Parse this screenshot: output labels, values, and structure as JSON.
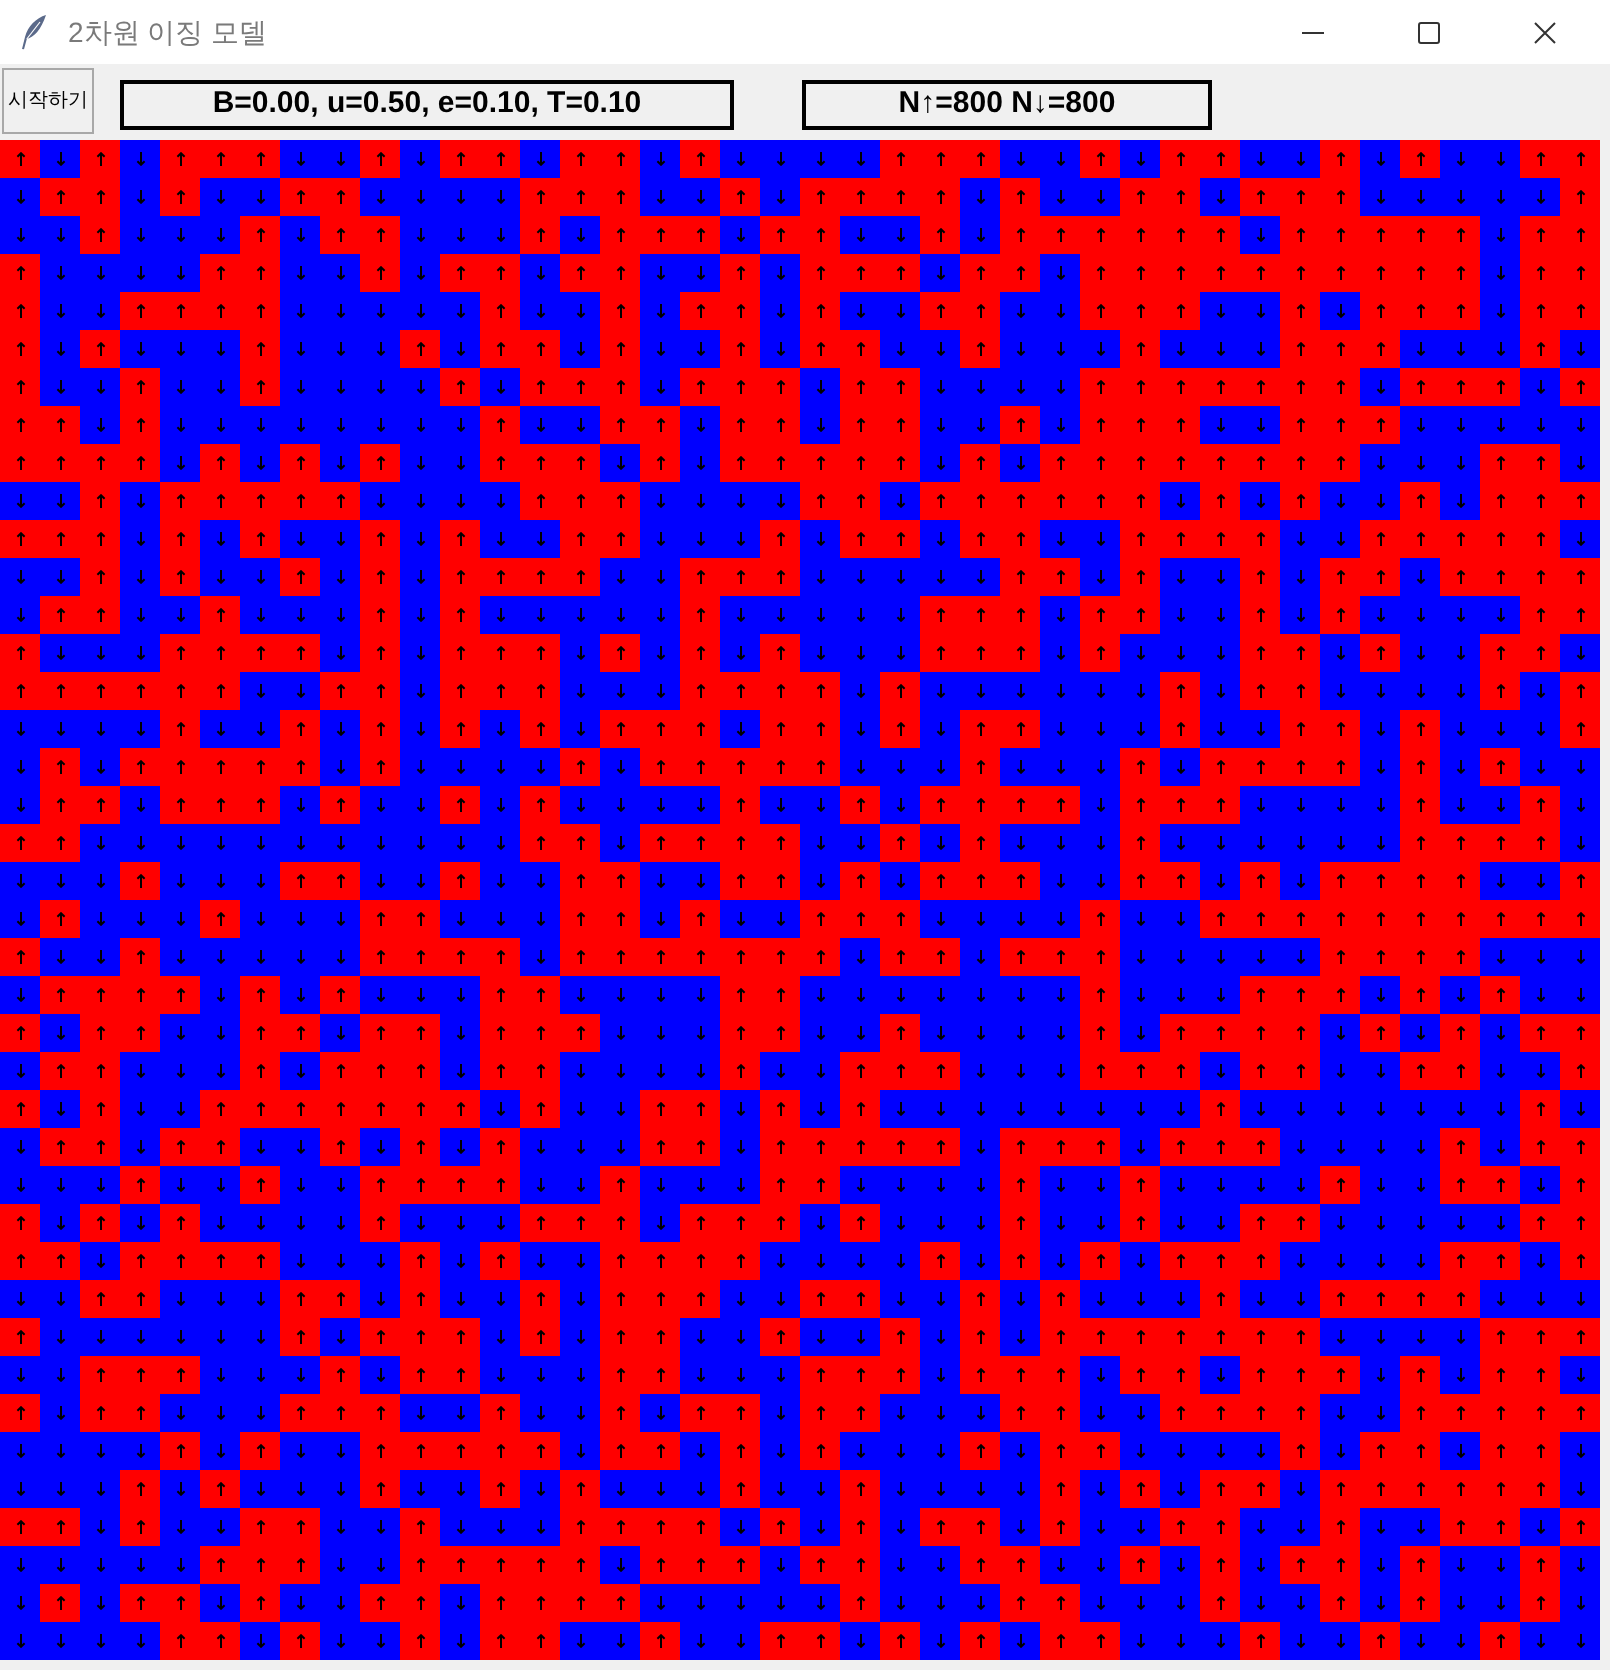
{
  "window": {
    "title": "2차원 이징 모델"
  },
  "toolbar": {
    "start_button": "시작하기",
    "parameters": "B=0.00, u=0.50, e=0.10, T=0.10",
    "counts": "N↑=800 N↓=800"
  },
  "lattice": {
    "spin_up": [
      [
        true,
        false,
        true,
        false,
        true,
        true,
        true,
        false,
        false,
        true,
        false,
        true,
        true,
        false,
        true,
        true,
        false,
        true,
        false,
        false,
        false,
        false,
        true,
        true,
        true,
        false,
        false,
        true,
        false,
        true,
        true,
        false,
        false,
        true,
        false,
        true,
        false,
        false,
        true,
        true
      ],
      [
        false,
        true,
        true,
        false,
        true,
        false,
        false,
        true,
        true,
        false,
        false,
        false,
        false,
        true,
        true,
        true,
        false,
        false,
        true,
        false,
        true,
        true,
        true,
        true,
        false,
        true,
        false,
        false,
        true,
        true,
        false,
        true,
        true,
        true,
        false,
        false,
        false,
        false,
        false,
        true
      ],
      [
        false,
        false,
        true,
        false,
        false,
        false,
        true,
        false,
        true,
        true,
        false,
        false,
        false,
        true,
        false,
        true,
        true,
        true,
        false,
        true,
        true,
        false,
        false,
        true,
        false,
        true,
        true,
        true,
        true,
        true,
        true,
        false,
        true,
        true,
        true,
        true,
        true,
        false,
        true,
        true
      ],
      [
        true,
        false,
        false,
        false,
        false,
        true,
        true,
        false,
        false,
        true,
        false,
        true,
        true,
        false,
        true,
        true,
        false,
        false,
        true,
        false,
        true,
        true,
        true,
        false,
        true,
        true,
        false,
        true,
        true,
        true,
        true,
        true,
        true,
        true,
        true,
        true,
        true,
        false,
        true,
        true
      ],
      [
        true,
        false,
        false,
        true,
        true,
        true,
        true,
        false,
        false,
        false,
        false,
        false,
        true,
        false,
        false,
        true,
        false,
        true,
        true,
        false,
        true,
        false,
        false,
        true,
        true,
        false,
        false,
        true,
        true,
        true,
        false,
        false,
        true,
        false,
        true,
        true,
        true,
        false,
        true,
        true
      ],
      [
        true,
        false,
        true,
        false,
        false,
        false,
        true,
        false,
        false,
        false,
        true,
        false,
        true,
        true,
        false,
        true,
        false,
        false,
        true,
        false,
        true,
        true,
        false,
        false,
        true,
        false,
        false,
        false,
        true,
        false,
        false,
        false,
        true,
        true,
        true,
        false,
        false,
        false,
        true,
        false
      ],
      [
        true,
        false,
        false,
        true,
        false,
        false,
        true,
        false,
        false,
        false,
        false,
        true,
        false,
        true,
        true,
        true,
        false,
        true,
        true,
        true,
        false,
        true,
        true,
        false,
        false,
        false,
        false,
        true,
        true,
        true,
        true,
        true,
        true,
        true,
        false,
        true,
        true,
        true,
        false,
        true
      ],
      [
        true,
        true,
        false,
        true,
        false,
        false,
        false,
        false,
        false,
        false,
        false,
        false,
        true,
        false,
        false,
        true,
        true,
        false,
        true,
        true,
        false,
        true,
        true,
        false,
        false,
        true,
        false,
        true,
        true,
        true,
        false,
        false,
        true,
        true,
        true,
        false,
        false,
        false,
        false,
        false
      ],
      [
        true,
        true,
        true,
        true,
        false,
        true,
        false,
        true,
        false,
        true,
        false,
        false,
        true,
        true,
        true,
        false,
        true,
        false,
        true,
        true,
        true,
        true,
        true,
        false,
        true,
        false,
        true,
        true,
        true,
        true,
        true,
        true,
        true,
        true,
        false,
        false,
        false,
        true,
        true,
        false
      ],
      [
        false,
        false,
        true,
        false,
        true,
        true,
        true,
        true,
        true,
        false,
        false,
        false,
        false,
        true,
        true,
        true,
        false,
        false,
        false,
        false,
        true,
        true,
        false,
        true,
        true,
        true,
        true,
        true,
        true,
        false,
        true,
        false,
        true,
        false,
        false,
        true,
        false,
        true,
        true,
        true
      ],
      [
        true,
        true,
        true,
        false,
        true,
        false,
        true,
        false,
        false,
        true,
        false,
        true,
        false,
        false,
        true,
        true,
        false,
        false,
        false,
        true,
        false,
        true,
        true,
        false,
        true,
        true,
        false,
        false,
        true,
        true,
        true,
        true,
        false,
        false,
        true,
        true,
        true,
        true,
        true,
        false
      ],
      [
        false,
        false,
        true,
        false,
        true,
        false,
        false,
        true,
        false,
        true,
        false,
        true,
        true,
        true,
        true,
        false,
        false,
        true,
        true,
        true,
        false,
        false,
        false,
        false,
        false,
        true,
        true,
        false,
        true,
        false,
        false,
        true,
        false,
        true,
        true,
        false,
        true,
        true,
        true,
        true
      ],
      [
        false,
        true,
        true,
        false,
        false,
        true,
        false,
        false,
        false,
        true,
        false,
        true,
        false,
        false,
        false,
        false,
        false,
        true,
        false,
        false,
        false,
        false,
        false,
        true,
        true,
        true,
        false,
        true,
        true,
        false,
        false,
        true,
        false,
        true,
        false,
        false,
        false,
        false,
        true,
        true
      ],
      [
        true,
        false,
        false,
        false,
        true,
        true,
        true,
        true,
        false,
        true,
        false,
        true,
        true,
        true,
        false,
        true,
        false,
        true,
        false,
        true,
        false,
        false,
        false,
        true,
        true,
        true,
        false,
        true,
        false,
        false,
        false,
        true,
        true,
        false,
        true,
        false,
        false,
        true,
        true,
        false
      ],
      [
        true,
        true,
        true,
        true,
        true,
        true,
        false,
        false,
        true,
        true,
        false,
        true,
        true,
        true,
        false,
        false,
        false,
        true,
        true,
        true,
        true,
        false,
        true,
        false,
        false,
        false,
        false,
        false,
        false,
        true,
        false,
        true,
        true,
        false,
        false,
        false,
        false,
        true,
        false,
        true
      ],
      [
        false,
        false,
        false,
        false,
        true,
        false,
        false,
        true,
        false,
        true,
        false,
        true,
        false,
        true,
        false,
        true,
        true,
        true,
        false,
        true,
        true,
        false,
        true,
        false,
        true,
        true,
        false,
        false,
        false,
        true,
        false,
        false,
        true,
        true,
        false,
        true,
        false,
        false,
        false,
        true
      ],
      [
        false,
        true,
        false,
        true,
        true,
        true,
        true,
        true,
        false,
        true,
        false,
        false,
        false,
        false,
        true,
        false,
        true,
        true,
        true,
        true,
        true,
        false,
        false,
        false,
        true,
        false,
        false,
        false,
        true,
        false,
        true,
        true,
        true,
        true,
        false,
        true,
        false,
        true,
        false,
        false
      ],
      [
        false,
        true,
        true,
        false,
        true,
        true,
        true,
        false,
        true,
        false,
        false,
        true,
        false,
        true,
        false,
        false,
        false,
        false,
        true,
        false,
        false,
        true,
        false,
        true,
        true,
        true,
        true,
        false,
        true,
        true,
        true,
        false,
        false,
        false,
        false,
        true,
        false,
        false,
        true,
        false
      ],
      [
        true,
        true,
        false,
        false,
        false,
        false,
        false,
        false,
        false,
        false,
        false,
        false,
        false,
        true,
        true,
        false,
        true,
        true,
        true,
        true,
        false,
        false,
        true,
        false,
        true,
        false,
        false,
        false,
        true,
        false,
        false,
        false,
        false,
        false,
        false,
        true,
        true,
        true,
        true,
        false
      ],
      [
        false,
        false,
        false,
        true,
        false,
        false,
        false,
        true,
        true,
        false,
        false,
        true,
        false,
        false,
        true,
        true,
        false,
        false,
        true,
        true,
        false,
        true,
        false,
        true,
        true,
        true,
        false,
        false,
        true,
        true,
        false,
        true,
        false,
        true,
        true,
        true,
        true,
        false,
        false,
        true
      ],
      [
        false,
        true,
        false,
        false,
        false,
        true,
        false,
        false,
        false,
        true,
        true,
        false,
        false,
        false,
        true,
        true,
        false,
        true,
        false,
        false,
        true,
        true,
        true,
        false,
        false,
        false,
        false,
        true,
        false,
        false,
        true,
        true,
        true,
        true,
        true,
        true,
        true,
        true,
        true,
        true
      ],
      [
        true,
        false,
        false,
        true,
        false,
        false,
        false,
        false,
        false,
        true,
        true,
        true,
        true,
        false,
        true,
        true,
        true,
        true,
        true,
        true,
        true,
        false,
        true,
        true,
        false,
        true,
        true,
        true,
        false,
        false,
        false,
        false,
        false,
        true,
        true,
        true,
        true,
        false,
        false,
        false
      ],
      [
        false,
        true,
        true,
        true,
        true,
        false,
        true,
        false,
        true,
        false,
        false,
        false,
        true,
        true,
        false,
        false,
        false,
        false,
        true,
        true,
        false,
        false,
        false,
        false,
        false,
        false,
        false,
        true,
        false,
        false,
        false,
        true,
        true,
        true,
        false,
        true,
        false,
        true,
        false,
        false
      ],
      [
        true,
        false,
        true,
        true,
        false,
        false,
        true,
        true,
        false,
        true,
        true,
        false,
        true,
        true,
        true,
        false,
        false,
        false,
        true,
        true,
        false,
        false,
        true,
        false,
        false,
        false,
        false,
        true,
        false,
        true,
        true,
        true,
        true,
        false,
        true,
        false,
        true,
        false,
        true,
        true
      ],
      [
        false,
        true,
        true,
        false,
        false,
        false,
        true,
        false,
        true,
        true,
        true,
        false,
        true,
        true,
        false,
        false,
        false,
        false,
        true,
        false,
        false,
        true,
        true,
        true,
        false,
        false,
        false,
        true,
        true,
        true,
        false,
        true,
        true,
        false,
        false,
        true,
        true,
        false,
        false,
        true
      ],
      [
        true,
        false,
        true,
        false,
        false,
        true,
        true,
        true,
        true,
        true,
        true,
        true,
        false,
        true,
        false,
        false,
        true,
        true,
        false,
        true,
        false,
        true,
        false,
        false,
        false,
        false,
        false,
        false,
        false,
        false,
        true,
        false,
        false,
        false,
        false,
        false,
        false,
        false,
        true,
        false
      ],
      [
        false,
        true,
        true,
        false,
        true,
        true,
        false,
        false,
        true,
        false,
        true,
        false,
        true,
        false,
        false,
        false,
        true,
        true,
        false,
        true,
        true,
        true,
        true,
        true,
        false,
        true,
        true,
        true,
        false,
        true,
        true,
        true,
        false,
        false,
        false,
        false,
        true,
        false,
        true,
        true
      ],
      [
        false,
        false,
        false,
        true,
        false,
        false,
        true,
        false,
        false,
        true,
        true,
        true,
        true,
        false,
        false,
        true,
        false,
        false,
        false,
        true,
        true,
        false,
        false,
        false,
        false,
        true,
        false,
        false,
        true,
        false,
        false,
        false,
        false,
        true,
        false,
        false,
        true,
        true,
        false,
        true
      ],
      [
        true,
        false,
        true,
        false,
        true,
        false,
        false,
        false,
        false,
        true,
        false,
        false,
        false,
        true,
        true,
        true,
        false,
        true,
        true,
        true,
        false,
        true,
        false,
        false,
        false,
        true,
        false,
        false,
        true,
        false,
        false,
        true,
        true,
        false,
        false,
        false,
        false,
        false,
        true,
        true
      ],
      [
        true,
        true,
        false,
        true,
        true,
        true,
        true,
        false,
        false,
        false,
        true,
        false,
        true,
        false,
        false,
        true,
        true,
        true,
        true,
        false,
        false,
        false,
        false,
        true,
        false,
        true,
        false,
        true,
        false,
        true,
        true,
        true,
        false,
        false,
        false,
        false,
        true,
        true,
        false,
        true
      ],
      [
        false,
        false,
        true,
        true,
        false,
        false,
        false,
        true,
        true,
        false,
        true,
        false,
        false,
        true,
        false,
        true,
        true,
        true,
        false,
        false,
        true,
        true,
        false,
        false,
        true,
        false,
        true,
        false,
        false,
        false,
        true,
        false,
        false,
        true,
        true,
        true,
        true,
        false,
        false,
        false
      ],
      [
        true,
        false,
        false,
        false,
        false,
        false,
        false,
        true,
        false,
        true,
        true,
        true,
        false,
        true,
        false,
        true,
        true,
        false,
        false,
        true,
        false,
        false,
        true,
        false,
        true,
        false,
        true,
        true,
        true,
        true,
        true,
        true,
        true,
        false,
        false,
        false,
        false,
        true,
        true,
        true
      ],
      [
        false,
        false,
        true,
        true,
        true,
        false,
        false,
        false,
        true,
        false,
        true,
        true,
        false,
        false,
        false,
        true,
        true,
        false,
        false,
        false,
        true,
        true,
        true,
        false,
        true,
        true,
        true,
        false,
        true,
        true,
        false,
        true,
        true,
        true,
        false,
        true,
        false,
        true,
        true,
        false
      ],
      [
        true,
        false,
        true,
        true,
        false,
        false,
        false,
        true,
        true,
        true,
        false,
        false,
        true,
        false,
        false,
        true,
        false,
        true,
        true,
        false,
        true,
        true,
        false,
        false,
        false,
        true,
        true,
        false,
        false,
        true,
        true,
        true,
        true,
        false,
        false,
        true,
        true,
        true,
        true,
        true
      ],
      [
        false,
        false,
        false,
        false,
        true,
        false,
        true,
        false,
        false,
        true,
        true,
        true,
        true,
        true,
        false,
        true,
        true,
        false,
        true,
        false,
        true,
        false,
        false,
        false,
        true,
        false,
        true,
        true,
        false,
        false,
        false,
        false,
        true,
        false,
        true,
        true,
        false,
        true,
        true,
        false
      ],
      [
        false,
        false,
        false,
        true,
        false,
        true,
        false,
        false,
        false,
        true,
        false,
        false,
        true,
        false,
        true,
        false,
        false,
        false,
        true,
        false,
        false,
        true,
        false,
        false,
        false,
        false,
        true,
        false,
        true,
        false,
        true,
        true,
        false,
        true,
        true,
        true,
        true,
        true,
        true,
        false
      ],
      [
        true,
        true,
        false,
        true,
        false,
        false,
        true,
        true,
        false,
        false,
        true,
        false,
        false,
        false,
        true,
        true,
        true,
        true,
        false,
        true,
        false,
        true,
        false,
        true,
        true,
        false,
        true,
        false,
        false,
        true,
        true,
        false,
        false,
        true,
        false,
        false,
        true,
        true,
        false,
        true
      ],
      [
        false,
        false,
        false,
        false,
        false,
        true,
        true,
        true,
        false,
        false,
        true,
        true,
        true,
        true,
        true,
        false,
        true,
        true,
        true,
        false,
        true,
        true,
        false,
        false,
        true,
        true,
        false,
        false,
        true,
        false,
        true,
        false,
        true,
        true,
        false,
        true,
        false,
        false,
        true,
        false
      ],
      [
        false,
        true,
        false,
        true,
        true,
        false,
        true,
        false,
        false,
        true,
        true,
        false,
        true,
        true,
        true,
        true,
        false,
        false,
        false,
        false,
        false,
        true,
        false,
        false,
        false,
        true,
        true,
        false,
        false,
        false,
        true,
        false,
        false,
        true,
        false,
        true,
        false,
        false,
        true,
        false
      ],
      [
        false,
        false,
        false,
        false,
        true,
        true,
        false,
        true,
        false,
        false,
        true,
        false,
        true,
        true,
        false,
        false,
        true,
        false,
        false,
        true,
        true,
        false,
        true,
        false,
        true,
        false,
        true,
        true,
        false,
        false,
        false,
        true,
        false,
        false,
        true,
        false,
        false,
        true,
        false,
        false
      ]
    ]
  }
}
